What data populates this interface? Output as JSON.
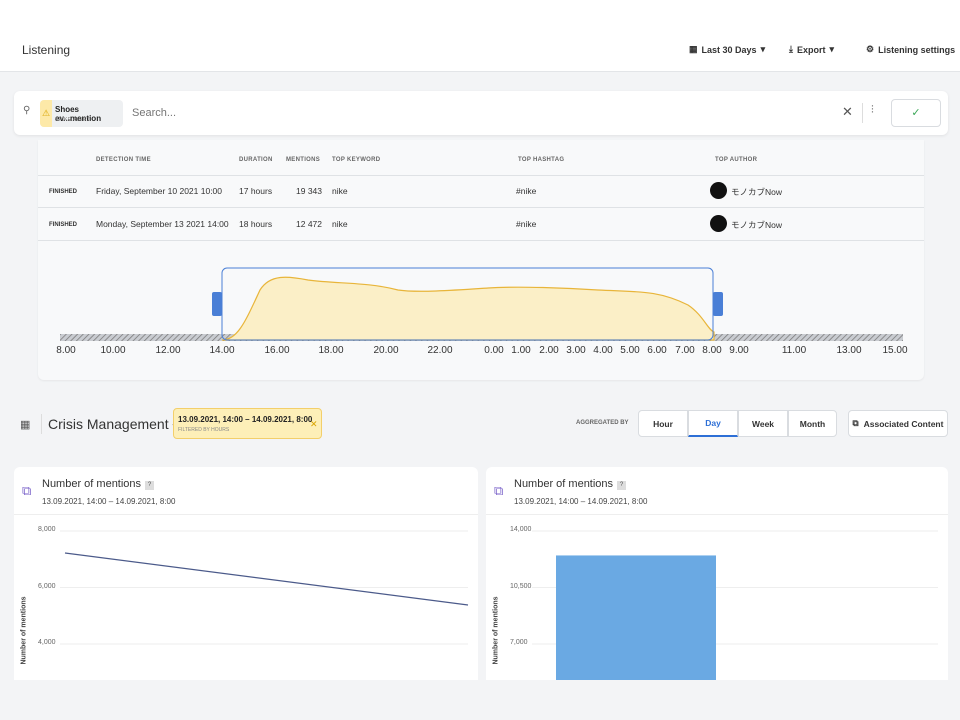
{
  "header": {
    "title": "Listening",
    "date_range": "Last 30 Days",
    "export": "Export",
    "settings": "Listening settings"
  },
  "search": {
    "chip_title": "Shoes ev...mention",
    "chip_subtitle": "SPIKE ALERT",
    "placeholder": "Search..."
  },
  "table": {
    "columns": [
      "DETECTION TIME",
      "DURATION",
      "MENTIONS",
      "TOP KEYWORD",
      "TOP HASHTAG",
      "TOP AUTHOR"
    ],
    "rows": [
      {
        "status": "FINISHED",
        "time": "Friday, September 10 2021 10:00",
        "duration": "17 hours",
        "mentions": "19 343",
        "keyword": "nike",
        "hashtag": "#nike",
        "author": "モノカブNow"
      },
      {
        "status": "FINISHED",
        "time": "Monday, September 13 2021 14:00",
        "duration": "18 hours",
        "mentions": "12 472",
        "keyword": "nike",
        "hashtag": "#nike",
        "author": "モノカブNow"
      }
    ]
  },
  "timeline": {
    "ticks": [
      "8.00",
      "10.00",
      "12.00",
      "14.00",
      "16.00",
      "18.00",
      "20.00",
      "22.00",
      "0.00",
      "1.00",
      "2.00",
      "3.00",
      "4.00",
      "5.00",
      "6.00",
      "7.00",
      "8.00",
      "9.00",
      "11.00",
      "13.00",
      "15.00"
    ],
    "colors": {
      "area": "#fbefc7",
      "line": "#e8b53a",
      "selection": "#4a7fd6"
    }
  },
  "toolbar": {
    "dashboard": "Crisis Management",
    "filter_range": "13.09.2021, 14:00 – 14.09.2021, 8:00",
    "filter_label": "FILTERED BY HOURS",
    "aggregated_by": "AGGREGATED BY",
    "options": [
      "Hour",
      "Day",
      "Week",
      "Month"
    ],
    "selected": "Day",
    "associated": "Associated Content"
  },
  "panels": [
    {
      "title": "Number of mentions",
      "subtitle": "13.09.2021, 14:00 – 14.09.2021, 8:00",
      "ylabel": "Number of mentions",
      "yticks": [
        "8,000",
        "6,000",
        "4,000"
      ],
      "type": "line",
      "values": [
        7214,
        5357
      ],
      "ylim": [
        4000,
        8000
      ],
      "color": "#4b5a8a"
    },
    {
      "title": "Number of mentions",
      "subtitle": "13.09.2021, 14:00 – 14.09.2021, 8:00",
      "ylabel": "Number of mentions",
      "yticks": [
        "14,000",
        "10,500",
        "7,000"
      ],
      "type": "bar",
      "values": [
        12472
      ],
      "ylim": [
        7000,
        14000
      ],
      "color": "#6aa9e3"
    }
  ]
}
